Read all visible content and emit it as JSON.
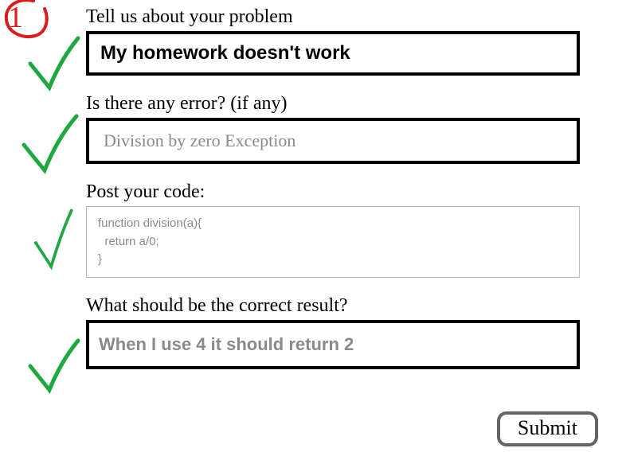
{
  "question_number": "1",
  "fields": {
    "problem": {
      "label": "Tell us about your problem",
      "value": "My homework doesn't work"
    },
    "error": {
      "label": "Is there any error?",
      "note": "(if any)",
      "value": "Division by zero Exception"
    },
    "code": {
      "label": "Post your code:",
      "value": "function division(a){\n  return a/0;\n}"
    },
    "expected": {
      "label": "What should be the correct result?",
      "value": "When I use 4 it should return 2"
    }
  },
  "submit_label": "Submit"
}
